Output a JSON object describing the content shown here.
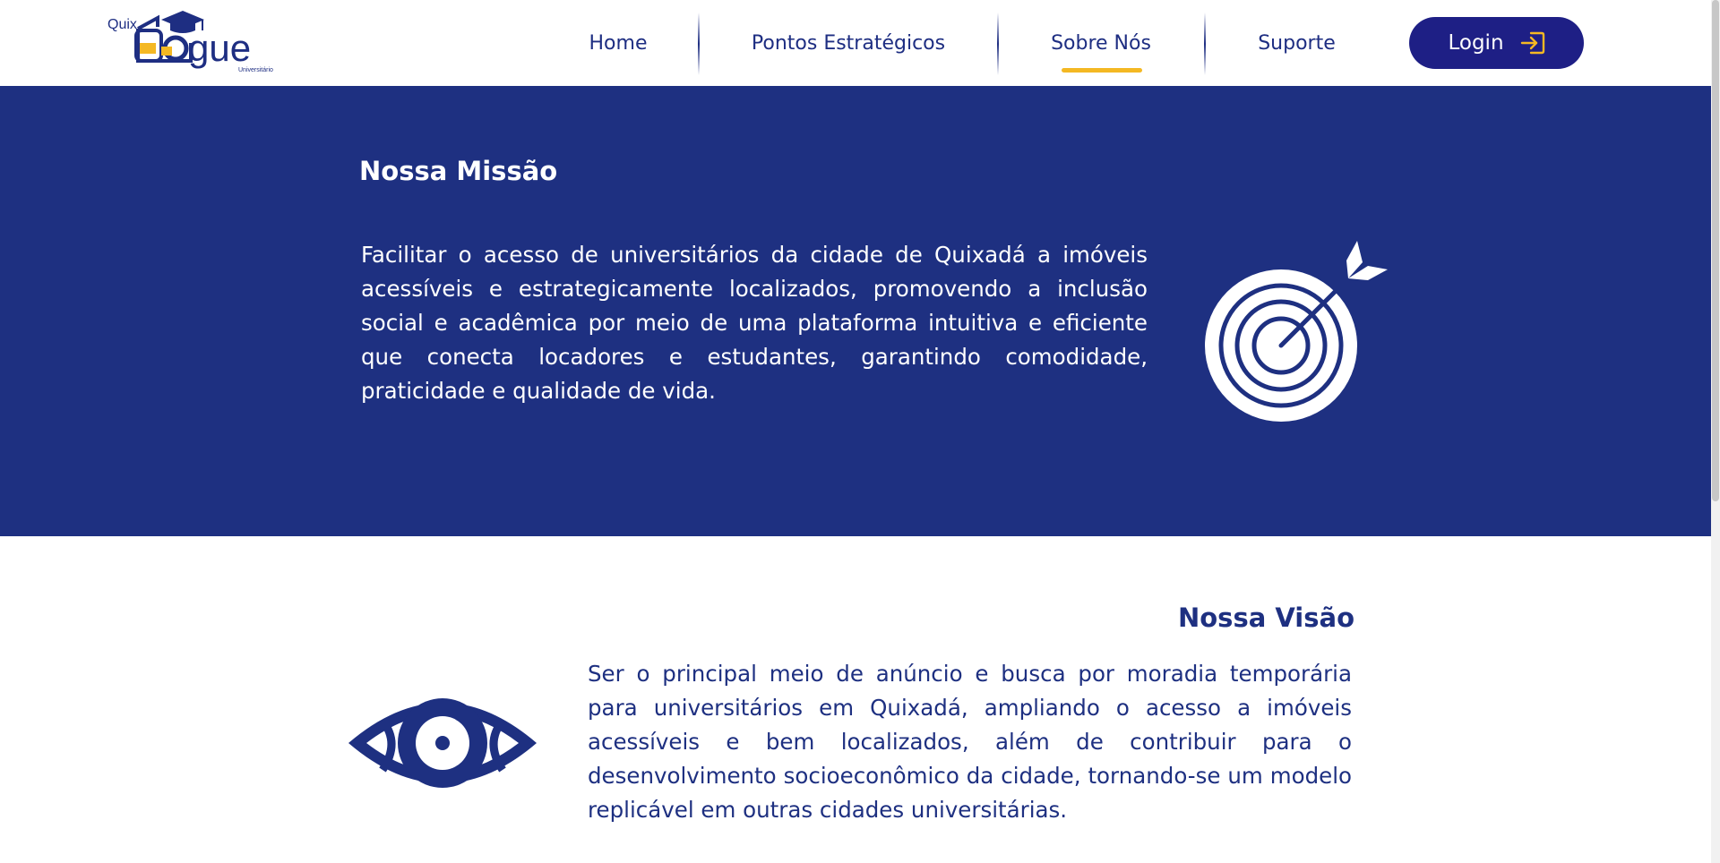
{
  "brand": {
    "logo_prefix": "Quix",
    "logo_main": "gue",
    "logo_subtitle": "Universitário",
    "colors": {
      "primary": "#1e3081",
      "accent": "#f4b823",
      "button": "#1e1f85"
    }
  },
  "nav": {
    "items": [
      {
        "label": "Home",
        "active": false
      },
      {
        "label": "Pontos Estratégicos",
        "active": false
      },
      {
        "label": "Sobre Nós",
        "active": true
      },
      {
        "label": "Suporte",
        "active": false
      }
    ],
    "login_label": "Login",
    "login_icon": "login-arrow-icon"
  },
  "mission": {
    "title": "Nossa Missão",
    "text": "Facilitar o acesso de universitários da cidade de Quixadá a imóveis acessíveis e estrategicamente localizados, promovendo a inclusão social e acadêmica por meio de uma plataforma intuitiva e eficiente que conecta locadores e estudantes, garantindo comodidade, praticidade e qualidade de vida.",
    "icon": "target-icon"
  },
  "vision": {
    "title": "Nossa Visão",
    "text": "Ser o principal meio de anúncio e busca por moradia temporária para universitários em Quixadá, ampliando o acesso a imóveis acessíveis e bem localizados, além de contribuir para o desenvolvimento socioeconômico da cidade, tornando-se um modelo replicável em outras cidades universitárias.",
    "icon": "eye-icon"
  }
}
